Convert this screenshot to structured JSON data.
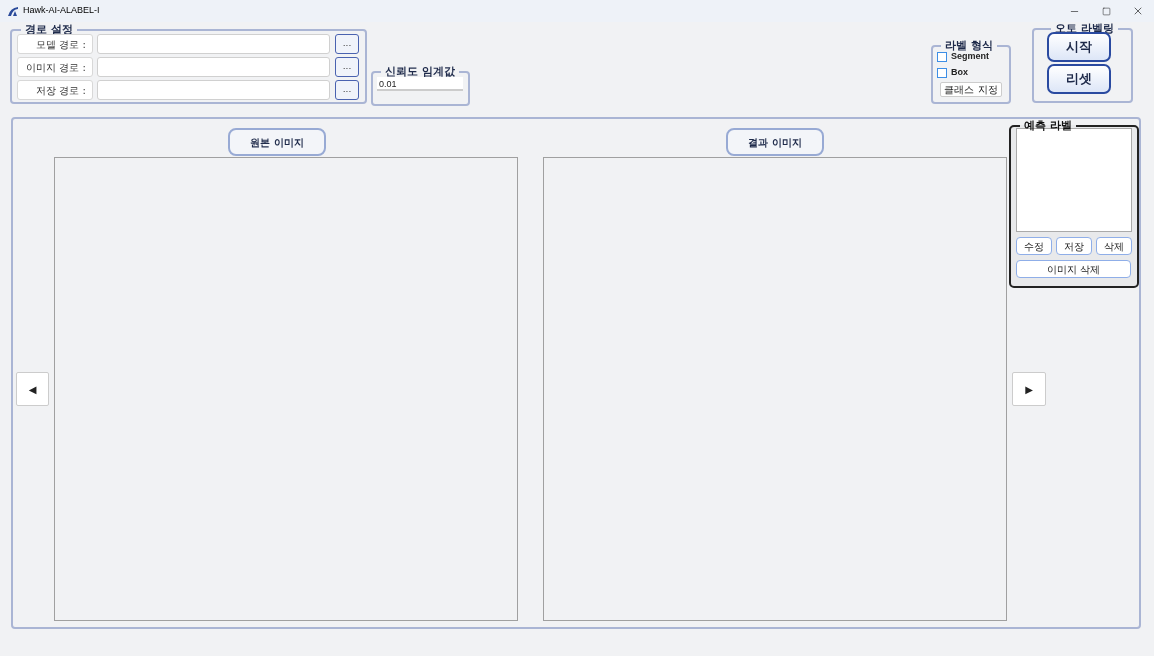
{
  "window": {
    "title": "Hawk-AI-ALABEL-I"
  },
  "path_settings": {
    "title": "경로 설정",
    "rows": [
      {
        "label": "모델 경로 :",
        "browse": "..."
      },
      {
        "label": "이미지 경로 :",
        "browse": "..."
      },
      {
        "label": "저장 경로 :",
        "browse": "..."
      }
    ]
  },
  "confidence": {
    "title": "신뢰도 임계값",
    "value": "0.01"
  },
  "label_format": {
    "title": "라벨 형식",
    "options": [
      {
        "label": "Segment",
        "checked": false
      },
      {
        "label": "Box",
        "checked": false
      }
    ],
    "class_button": "클래스 지정"
  },
  "auto_labeling": {
    "title": "오토 라벨링",
    "buttons": [
      "시작",
      "리셋"
    ]
  },
  "nav": {
    "prev": "◀",
    "next": "▶"
  },
  "panels": [
    {
      "title": "원본 이미지"
    },
    {
      "title": "결과 이미지"
    }
  ],
  "prediction": {
    "title": "예측 라벨",
    "buttons": [
      "수정",
      "저장",
      "삭제"
    ],
    "delete_image": "이미지 삭제"
  }
}
